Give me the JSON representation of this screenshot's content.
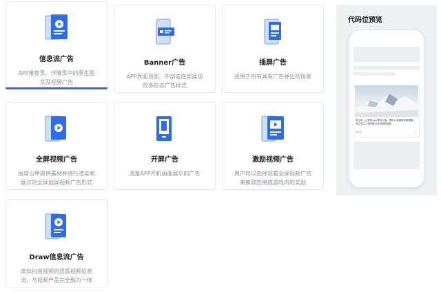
{
  "colors": {
    "accent": "#2d6bf0",
    "icon_light": "#bcd3f7",
    "icon_dark": "#2d6bf0"
  },
  "cards": [
    {
      "title": "信息流广告",
      "desc": [
        "APP推荐页、详情页中的原生图",
        "文及视频广告"
      ],
      "icon": "phone-feed-video-icon",
      "selected": true
    },
    {
      "title": "Banner广告",
      "desc": [
        "APP界面顶部、中部或底部展现",
        "的多形态广告样式"
      ],
      "icon": "phone-banner-icon",
      "selected": false
    },
    {
      "title": "插屏广告",
      "desc": [
        "适用于所有具有广告弹出的场景"
      ],
      "icon": "phone-interstitial-icon",
      "selected": false
    },
    {
      "title": "全屏视频广告",
      "desc": [
        "由穿山甲提供素材并进行渲染和",
        "展示的全屏插屏视频广告形式"
      ],
      "icon": "phone-fullscreen-video-icon",
      "selected": false
    },
    {
      "title": "开屏广告",
      "desc": [
        "流量APP开机画面展示的广告"
      ],
      "icon": "phone-splash-icon",
      "selected": false
    },
    {
      "title": "激励视频广告",
      "desc": [
        "用户可以选择观看全屏视频广告",
        "来换取应用或游戏内的奖励"
      ],
      "icon": "phone-rewarded-video-icon",
      "selected": false
    },
    {
      "title": "Draw信息流广告",
      "desc": [
        "类似抖音视频的竖版视频信息",
        "流，与视频产品完全融为一体"
      ],
      "icon": "phone-draw-feed-icon",
      "selected": false
    }
  ],
  "preview": {
    "title": "代码位预览",
    "ad_text": "穿山甲，让变现app更有价值。携码计量增特加新更趣，回山意生-v提测推万此收费顾信程",
    "ad_tag": "穿山甲",
    "ad_close": "×"
  }
}
